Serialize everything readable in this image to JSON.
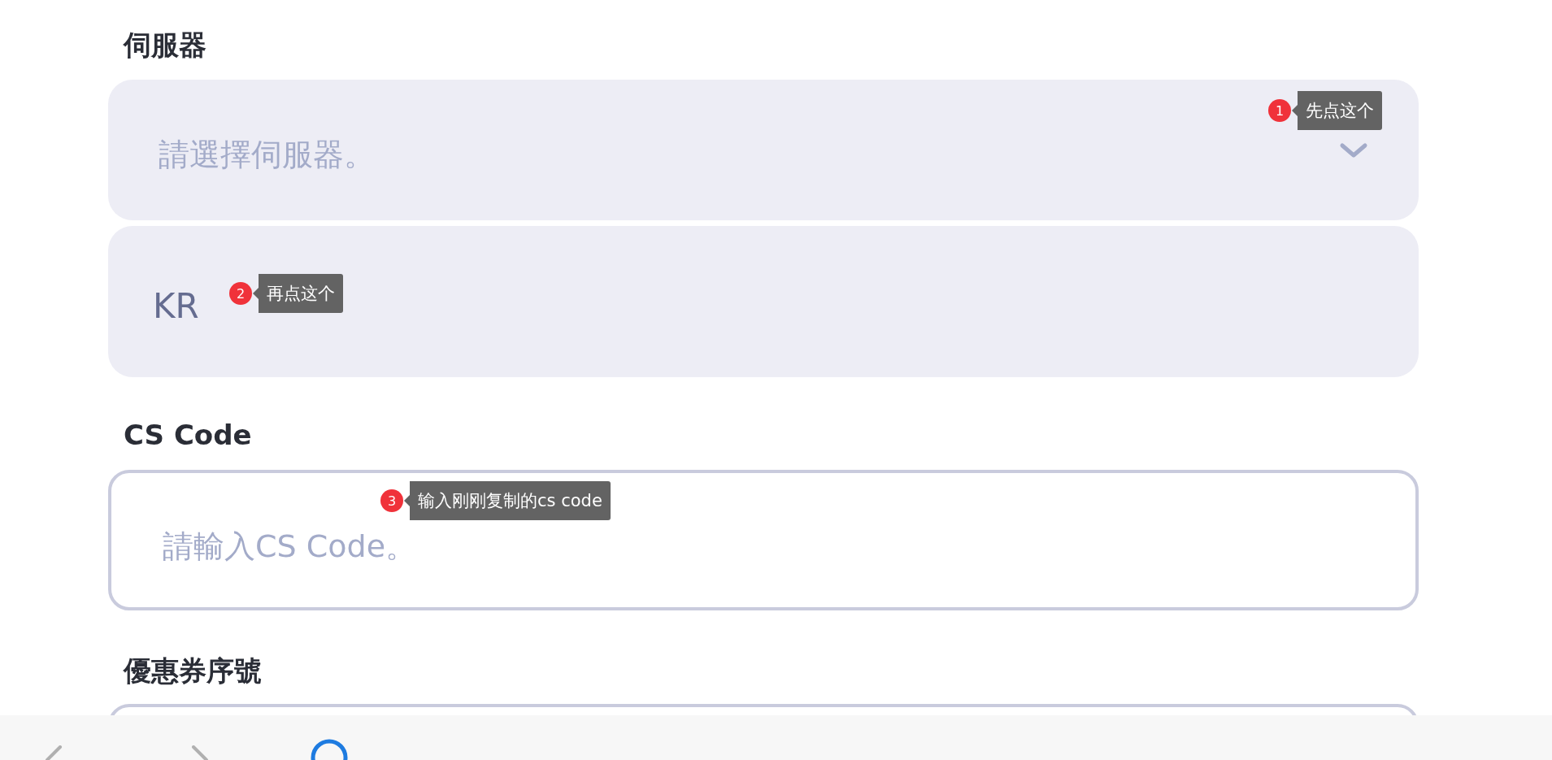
{
  "server": {
    "label": "伺服器",
    "placeholder": "請選擇伺服器。",
    "annotation": {
      "number": "1",
      "text": "先点这个"
    },
    "option": {
      "text": "KR",
      "annotation": {
        "number": "2",
        "text": "再点这个"
      }
    }
  },
  "cs_code": {
    "label": "CS Code",
    "placeholder": "請輸入CS Code。",
    "annotation": {
      "number": "3",
      "text": "输入刚刚复制的cs code"
    }
  },
  "coupon": {
    "label": "優惠券序號"
  }
}
